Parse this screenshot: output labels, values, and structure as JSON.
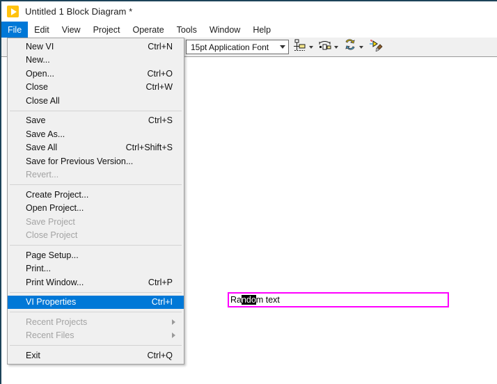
{
  "window": {
    "title": "Untitled 1 Block Diagram *",
    "app_icon": "run-arrow-icon",
    "accent_color": "#0078d7",
    "border_color": "#1d4359"
  },
  "menubar": {
    "items": [
      {
        "label": "File",
        "active": true
      },
      {
        "label": "Edit",
        "active": false
      },
      {
        "label": "View",
        "active": false
      },
      {
        "label": "Project",
        "active": false
      },
      {
        "label": "Operate",
        "active": false
      },
      {
        "label": "Tools",
        "active": false
      },
      {
        "label": "Window",
        "active": false
      },
      {
        "label": "Help",
        "active": false
      }
    ]
  },
  "toolbar": {
    "font_combo": {
      "value": "15pt Application Font",
      "icon": "chevron-down-icon"
    },
    "buttons": [
      {
        "name": "align-objects-button",
        "icon": "align-objects-icon"
      },
      {
        "name": "distribute-objects-button",
        "icon": "distribute-objects-icon"
      },
      {
        "name": "reorder-button",
        "icon": "reorder-icon"
      },
      {
        "name": "clean-up-diagram-button",
        "icon": "clean-up-diagram-icon"
      }
    ]
  },
  "file_menu": {
    "rows": [
      {
        "type": "item",
        "label": "New VI",
        "accel": "Ctrl+N",
        "state": "normal"
      },
      {
        "type": "item",
        "label": "New...",
        "accel": "",
        "state": "normal"
      },
      {
        "type": "item",
        "label": "Open...",
        "accel": "Ctrl+O",
        "state": "normal"
      },
      {
        "type": "item",
        "label": "Close",
        "accel": "Ctrl+W",
        "state": "normal"
      },
      {
        "type": "item",
        "label": "Close All",
        "accel": "",
        "state": "normal"
      },
      {
        "type": "separator"
      },
      {
        "type": "item",
        "label": "Save",
        "accel": "Ctrl+S",
        "state": "normal"
      },
      {
        "type": "item",
        "label": "Save As...",
        "accel": "",
        "state": "normal"
      },
      {
        "type": "item",
        "label": "Save All",
        "accel": "Ctrl+Shift+S",
        "state": "normal"
      },
      {
        "type": "item",
        "label": "Save for Previous Version...",
        "accel": "",
        "state": "normal"
      },
      {
        "type": "item",
        "label": "Revert...",
        "accel": "",
        "state": "disabled"
      },
      {
        "type": "separator"
      },
      {
        "type": "item",
        "label": "Create Project...",
        "accel": "",
        "state": "normal"
      },
      {
        "type": "item",
        "label": "Open Project...",
        "accel": "",
        "state": "normal"
      },
      {
        "type": "item",
        "label": "Save Project",
        "accel": "",
        "state": "disabled"
      },
      {
        "type": "item",
        "label": "Close Project",
        "accel": "",
        "state": "disabled"
      },
      {
        "type": "separator"
      },
      {
        "type": "item",
        "label": "Page Setup...",
        "accel": "",
        "state": "normal"
      },
      {
        "type": "item",
        "label": "Print...",
        "accel": "",
        "state": "normal"
      },
      {
        "type": "item",
        "label": "Print Window...",
        "accel": "Ctrl+P",
        "state": "normal"
      },
      {
        "type": "separator"
      },
      {
        "type": "item",
        "label": "VI Properties",
        "accel": "Ctrl+I",
        "state": "selected"
      },
      {
        "type": "separator"
      },
      {
        "type": "item",
        "label": "Recent Projects",
        "accel": "",
        "state": "disabled",
        "submenu": true
      },
      {
        "type": "item",
        "label": "Recent Files",
        "accel": "",
        "state": "disabled",
        "submenu": true
      },
      {
        "type": "separator"
      },
      {
        "type": "item",
        "label": "Exit",
        "accel": "Ctrl+Q",
        "state": "normal"
      }
    ]
  },
  "canvas": {
    "label_object": {
      "text_before": "Ra",
      "text_selected": "ndo",
      "text_after": "m text",
      "full_text": "Random text",
      "border_color": "#ff00ff",
      "selection_color": "#000000"
    }
  }
}
